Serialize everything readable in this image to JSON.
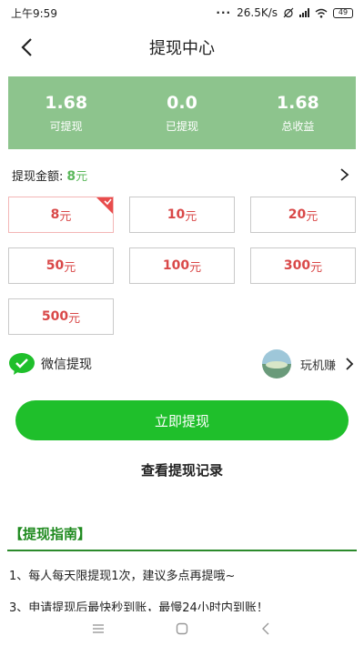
{
  "status_bar": {
    "time": "上午9:59",
    "dots": "···",
    "speed": "26.5K/s",
    "battery": "49"
  },
  "header": {
    "title": "提现中心"
  },
  "summary": {
    "items": [
      {
        "value": "1.68",
        "label": "可提现"
      },
      {
        "value": "0.0",
        "label": "已提现"
      },
      {
        "value": "1.68",
        "label": "总收益"
      }
    ]
  },
  "amount": {
    "label": "提现金额:",
    "value": "8",
    "unit": "元"
  },
  "options": [
    {
      "value": "8",
      "unit": "元",
      "selected": true
    },
    {
      "value": "10",
      "unit": "元"
    },
    {
      "value": "20",
      "unit": "元"
    },
    {
      "value": "50",
      "unit": "元"
    },
    {
      "value": "100",
      "unit": "元"
    },
    {
      "value": "300",
      "unit": "元"
    },
    {
      "value": "500",
      "unit": "元"
    }
  ],
  "method": {
    "label": "微信提现",
    "partner_name": "玩机赚"
  },
  "actions": {
    "withdraw_button": "立即提现",
    "records_link": "查看提现记录"
  },
  "guide": {
    "title": "【提现指南】",
    "items": [
      "1、每人每天限提现1次，建议多点再提哦~",
      "3、申请提现后最快秒到账，最慢24小时内到账！"
    ]
  },
  "colors": {
    "accent_green": "#1fbf2b",
    "summary_bg": "#8dc48d",
    "amount_red": "#d94848"
  }
}
